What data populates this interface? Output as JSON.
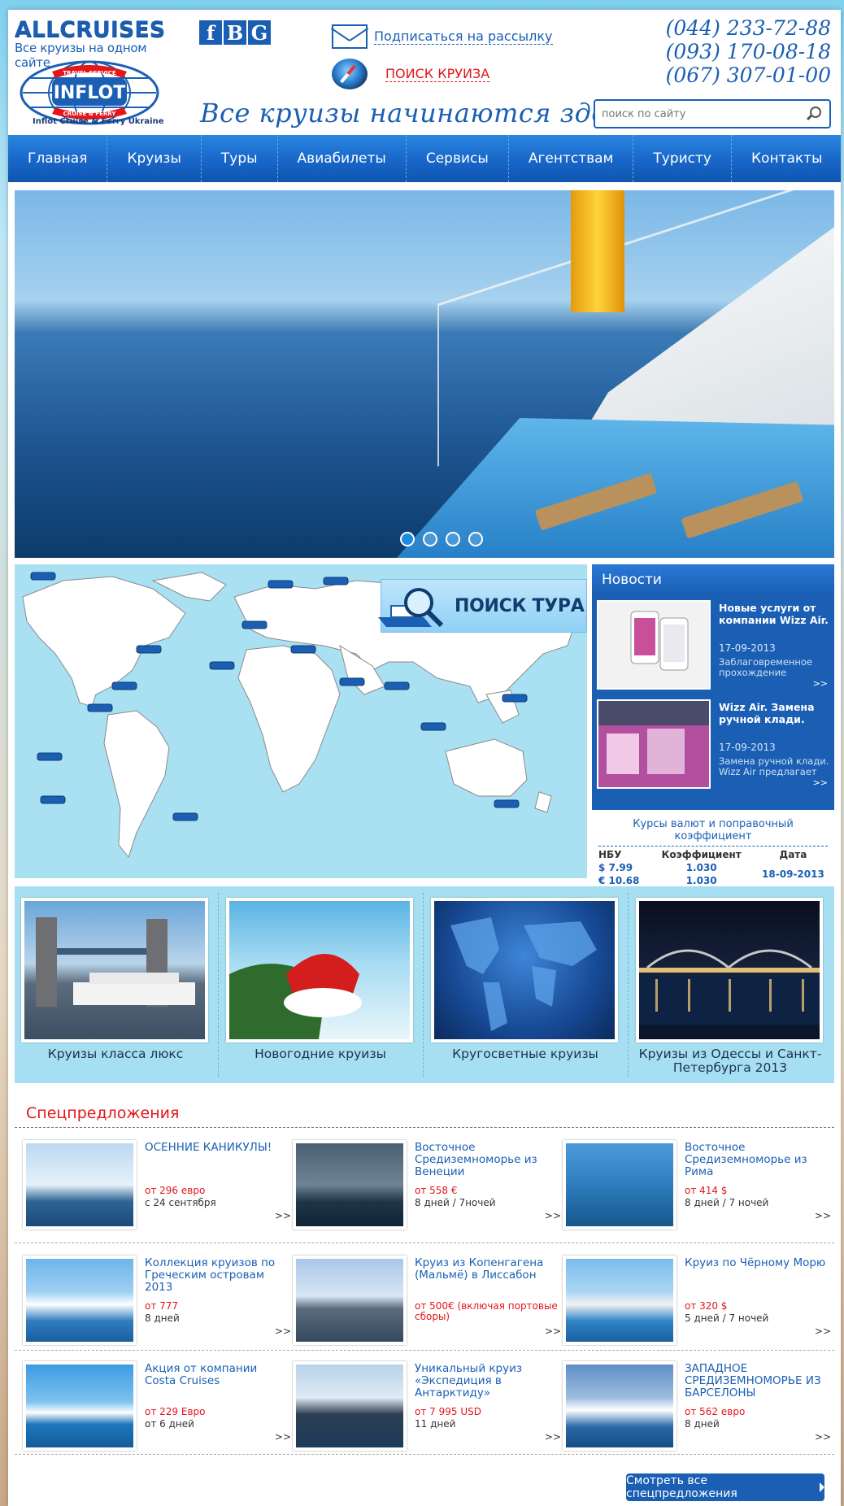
{
  "brand": {
    "name": "ALLCRUISES",
    "tagline": "Все круизы на одном сайте",
    "logo_top": "TRAVEL SERVICE",
    "logo_main": "INFLOT",
    "logo_bottom": "CRUISE & FERRY",
    "logo_sub": "Inflot Cruise & Ferry Ukraine"
  },
  "social": [
    "f",
    "B",
    "G"
  ],
  "subscribe": "Подписаться на рассылку",
  "cruise_search": "ПОИСК КРУИЗА",
  "slogan": "Все круизы начинаются здесь!",
  "phones": [
    "(044)  233-72-88",
    "(093)  170-08-18",
    "(067)  307-01-00"
  ],
  "site_search": {
    "placeholder": "поиск по сайту"
  },
  "nav": [
    "Главная",
    "Круизы",
    "Туры",
    "Авиабилеты",
    "Сервисы",
    "Агентствам",
    "Туристу",
    "Контакты"
  ],
  "slider": {
    "slide_count": 4,
    "active_slide": 1
  },
  "map": {
    "search_tour_label": "ПОИСК ТУРА"
  },
  "news": {
    "title": "Новости",
    "items": [
      {
        "headline": "Новые услуги от компании Wizz Air.",
        "date": "17-09-2013",
        "desc": "Заблаговременное прохождение",
        "more": ">>"
      },
      {
        "headline": "Wizz Air. Замена ручной клади.",
        "date": "17-09-2013",
        "desc": "Замена ручной клади. Wizz Air предлагает",
        "more": ">>"
      }
    ]
  },
  "rates": {
    "title": "Курсы валют и поправочный коэффициент",
    "headers": [
      "НБУ",
      "Коэффициент",
      "Дата"
    ],
    "rows": [
      {
        "rate": "$ 7.99",
        "coef": "1.030"
      },
      {
        "rate": "€ 10.68",
        "coef": "1.030"
      }
    ],
    "date": "18-09-2013"
  },
  "categories": [
    "Круизы класса люкс",
    "Новогодние круизы",
    "Кругосветные круизы",
    "Круизы из Одессы и Санкт-Петербурга 2013"
  ],
  "specials": {
    "title": "Спецпредложения",
    "offers": [
      {
        "title": "ОСЕННИЕ КАНИКУЛЫ!",
        "price": "от 296 евро",
        "duration": "с 24 сентября",
        "more": ">>"
      },
      {
        "title": "Восточное Средиземноморье из Венеции",
        "price": "от 558 €",
        "duration": "8 дней / 7ночей",
        "more": ">>"
      },
      {
        "title": "Восточное Средиземноморье из Рима",
        "price": "от 414 $",
        "duration": "8 дней / 7 ночей",
        "more": ">>"
      },
      {
        "title": "Коллекция круизов по Греческим островам 2013",
        "price": "от 777",
        "duration": "8 дней",
        "more": ">>"
      },
      {
        "title": "Круиз из Копенгагена (Мальмё) в Лиссабон",
        "price": "от 500€ (включая портовые сборы)",
        "duration": "",
        "more": ">>"
      },
      {
        "title": "Круиз по Чёрному Морю",
        "price": "от 320 $",
        "duration": "5 дней / 7 ночей",
        "more": ">>"
      },
      {
        "title": "Акция от компании Costa Cruises",
        "price": "от 229 Евро",
        "duration": "от 6 дней",
        "more": ">>"
      },
      {
        "title": "Уникальный круиз «Экспедиция в Антарктиду»",
        "price": "от 7 995 USD",
        "duration": "11 дней",
        "more": ">>"
      },
      {
        "title": "ЗАПАДНОЕ СРЕДИЗЕМНОМОРЬЕ ИЗ БАРСЕЛОНЫ",
        "price": "от 562 евро",
        "duration": "8 дней",
        "more": ">>"
      }
    ],
    "all_button": "Смотреть все спецпредложения"
  },
  "colors": {
    "brand_blue": "#1a5fb4",
    "accent_red": "#e3161b",
    "light_blue": "#a7dff2"
  }
}
